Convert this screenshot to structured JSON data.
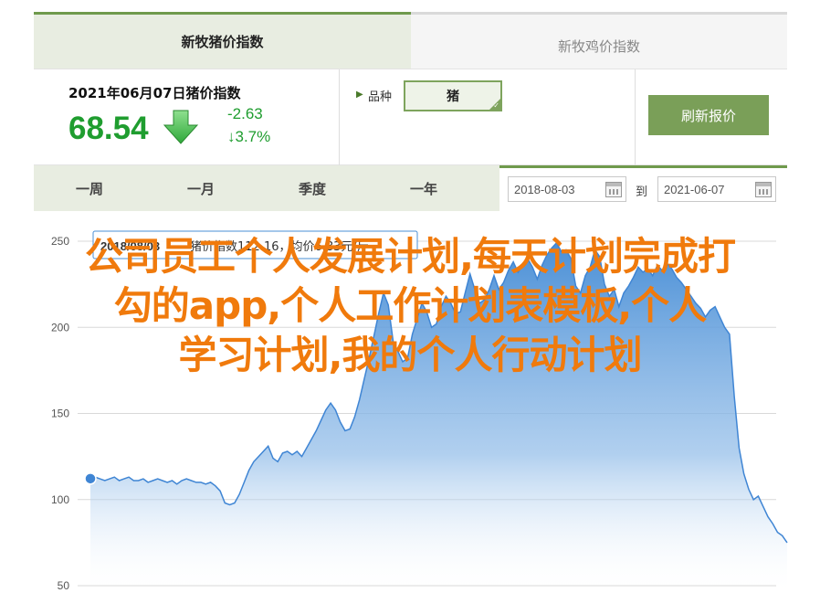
{
  "tabs": {
    "active": "新牧猪价指数",
    "inactive": "新牧鸡价指数"
  },
  "summary": {
    "date_title": "2021年06月07日猪价指数",
    "price": "68.54",
    "change": "-2.63",
    "change_pct": "↓3.7%",
    "trend_icon": "down-arrow-icon",
    "variety_label": "品种",
    "variety_value": "猪",
    "refresh_label": "刷新报价"
  },
  "periods": [
    "一周",
    "一月",
    "季度",
    "一年"
  ],
  "daterange": {
    "start": "2018-08-03",
    "to_label": "到",
    "end": "2021-06-07"
  },
  "tooltip": {
    "date": "2018/08/03",
    "text": "猪价指数112.16，均价6.83元/斤"
  },
  "overlay": {
    "line1": "公司员工个人发展计划,每天计划完成打",
    "line2": "勾的app,个人工作计划表模板,个人",
    "line3": "学习计划,我的个人行动计划"
  },
  "colors": {
    "accent_green": "#6f9a4c",
    "price_green": "#1f9d2f",
    "line_blue": "#4a8fd6",
    "overlay_orange": "#f07a0c"
  },
  "chart_data": {
    "type": "area",
    "title": "",
    "xlabel": "",
    "ylabel": "",
    "ylim": [
      50,
      250
    ],
    "yticks": [
      50,
      100,
      150,
      200,
      250
    ],
    "grid": true,
    "start_date": "2018-08-03",
    "end_date": "2021-06-07",
    "series": [
      {
        "values": [
          112.16,
          113,
          112,
          111,
          112,
          113,
          111,
          112,
          113,
          111,
          111,
          112,
          110,
          111,
          112,
          111,
          110,
          111,
          109,
          111,
          112,
          111,
          110,
          110,
          109,
          110,
          108,
          105,
          98,
          97,
          98,
          103,
          110,
          117,
          122,
          125,
          128,
          131,
          124,
          122,
          127,
          128,
          126,
          128,
          125,
          130,
          135,
          140,
          146,
          152,
          156,
          152,
          145,
          140,
          141,
          148,
          158,
          170,
          182,
          195,
          208,
          220,
          213,
          192,
          186,
          180,
          182,
          196,
          205,
          214,
          209,
          200,
          202,
          212,
          218,
          214,
          208,
          209,
          220,
          231,
          222,
          214,
          216,
          222,
          230,
          222,
          226,
          233,
          238,
          232,
          236,
          240,
          235,
          228,
          236,
          242,
          246,
          249,
          244,
          245,
          240,
          224,
          220,
          230,
          235,
          245,
          241,
          225,
          218,
          222,
          212,
          220,
          224,
          229,
          235,
          232,
          234,
          230,
          236,
          233,
          237,
          234,
          229,
          226,
          222,
          218,
          214,
          211,
          206,
          210,
          212,
          206,
          200,
          196,
          160,
          130,
          115,
          106,
          100,
          102,
          96,
          90,
          86,
          81,
          79,
          75
        ]
      }
    ]
  }
}
